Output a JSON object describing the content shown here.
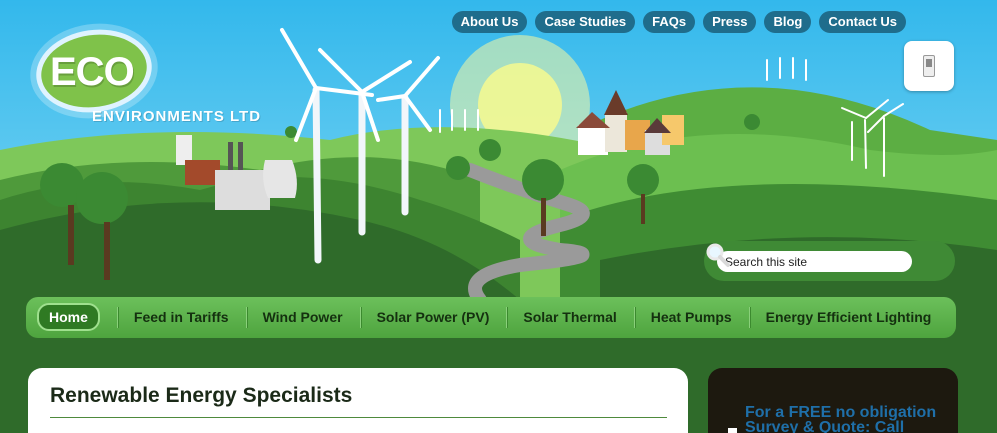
{
  "logo": {
    "main": "ECO",
    "sub": "ENVIRONMENTS LTD"
  },
  "top_nav": [
    "About Us",
    "Case Studies",
    "FAQs",
    "Press",
    "Blog",
    "Contact Us"
  ],
  "search": {
    "value": "Search this site",
    "icon": "magnifier-icon"
  },
  "main_nav": {
    "active_index": 0,
    "items": [
      "Home",
      "Feed in Tariffs",
      "Wind Power",
      "Solar Power (PV)",
      "Solar Thermal",
      "Heat Pumps",
      "Energy Efficient Lighting"
    ]
  },
  "content": {
    "heading": "Renewable Energy Specialists"
  },
  "sidebar": {
    "promo": "For a FREE no obligation Survey & Quote: Call"
  },
  "colors": {
    "sky": "#33b8ec",
    "hills_dark": "#2f6b2a",
    "hills_light": "#6cc05b",
    "nav_pill": "#1f6d8c",
    "promo_text": "#1f6fa8"
  }
}
